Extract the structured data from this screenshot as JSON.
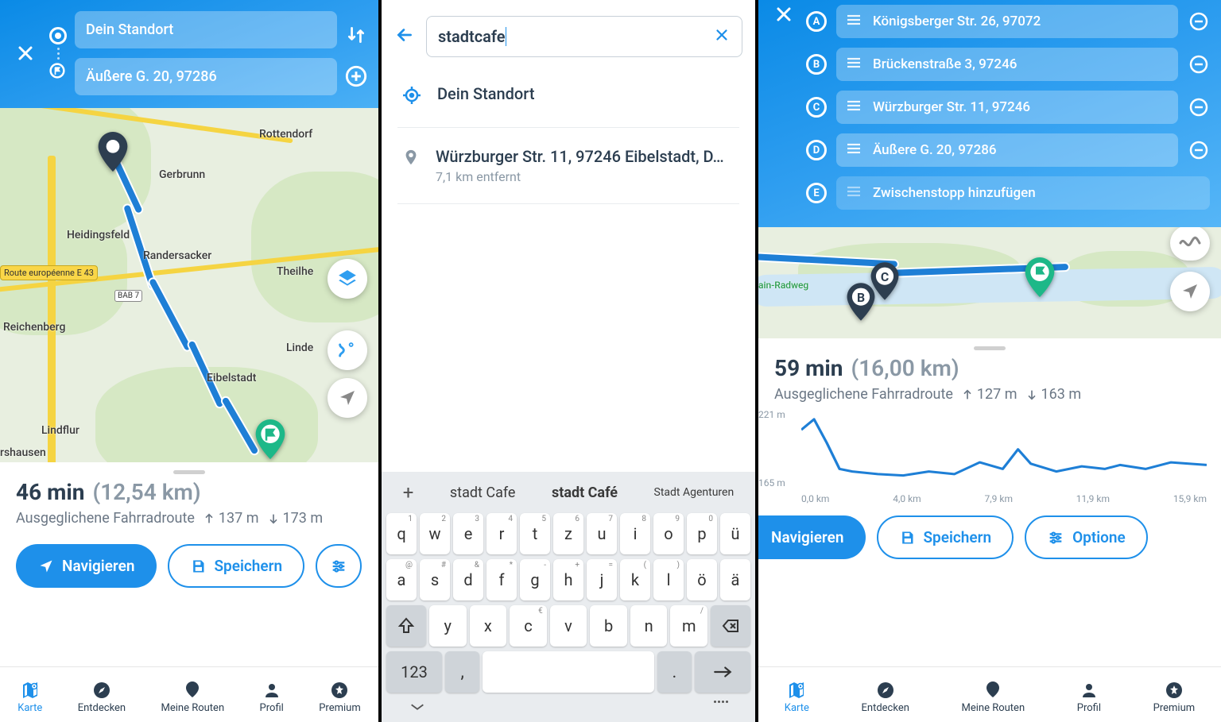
{
  "screen1": {
    "start_placeholder": "Dein Standort",
    "destination": "Äußere G. 20, 97286",
    "map_labels": {
      "rottendorf": "Rottendorf",
      "gerbrunn": "Gerbrunn",
      "heidingsfeld": "Heidingsfeld",
      "randersacker": "Randersacker",
      "theilhe": "Theilhe",
      "reichenberg": "Reichenberg",
      "linde": "Linde",
      "eibelstadt": "Eibelstadt",
      "lindflur": "Lindflur",
      "rshausen": "rshausen",
      "route_europe": "Route européenne E 43",
      "bab": "BAB 7"
    },
    "duration": "46 min",
    "distance": "(12,54 km)",
    "route_type": "Ausgeglichene Fahrradroute",
    "ascent": "137 m",
    "descent": "173 m",
    "btn_navigate": "Navigieren",
    "btn_save": "Speichern"
  },
  "screen2": {
    "search_value": "stadtcafe",
    "sugg_current": "Dein Standort",
    "sugg_addr_title": "Würzburger Str. 11, 97246 Eibelstadt, D…",
    "sugg_addr_sub": "7,1 km entfernt",
    "kbd_sugg1": "stadt Cafe",
    "kbd_sugg2": "stadt Café",
    "kbd_sugg3": "Stadt Agenturen",
    "keys_row1": [
      {
        "k": "q",
        "a": "1"
      },
      {
        "k": "w",
        "a": "2"
      },
      {
        "k": "e",
        "a": "3"
      },
      {
        "k": "r",
        "a": "4"
      },
      {
        "k": "t",
        "a": "5"
      },
      {
        "k": "z",
        "a": "6"
      },
      {
        "k": "u",
        "a": "7"
      },
      {
        "k": "i",
        "a": "8"
      },
      {
        "k": "o",
        "a": "9"
      },
      {
        "k": "p",
        "a": "0"
      },
      {
        "k": "ü",
        "a": ""
      }
    ],
    "keys_row2": [
      {
        "k": "a",
        "a": "@"
      },
      {
        "k": "s",
        "a": "#"
      },
      {
        "k": "d",
        "a": "&"
      },
      {
        "k": "f",
        "a": "*"
      },
      {
        "k": "g",
        "a": "-"
      },
      {
        "k": "h",
        "a": "+"
      },
      {
        "k": "j",
        "a": "="
      },
      {
        "k": "k",
        "a": "("
      },
      {
        "k": "l",
        "a": ")"
      },
      {
        "k": "ö",
        "a": ""
      },
      {
        "k": "ä",
        "a": ""
      }
    ],
    "keys_row3": [
      {
        "k": "y",
        "a": ""
      },
      {
        "k": "x",
        "a": ""
      },
      {
        "k": "c",
        "a": "€"
      },
      {
        "k": "v",
        "a": ""
      },
      {
        "k": "b",
        "a": ""
      },
      {
        "k": "n",
        "a": ""
      },
      {
        "k": "m",
        "a": "/"
      }
    ],
    "key_123": "123"
  },
  "screen3": {
    "stops": [
      {
        "letter": "A",
        "text": "Königsberger Str. 26, 97072"
      },
      {
        "letter": "B",
        "text": "Brückenstraße 3, 97246"
      },
      {
        "letter": "C",
        "text": "Würzburger Str. 11, 97246"
      },
      {
        "letter": "D",
        "text": "Äußere G. 20, 97286"
      },
      {
        "letter": "E",
        "text": "Zwischenstopp hinzufügen"
      }
    ],
    "map_label_radweg": "ain-Radweg",
    "duration": "59 min",
    "distance": "(16,00 km)",
    "route_type": "Ausgeglichene Fahrradroute",
    "ascent": "127 m",
    "descent": "163 m",
    "btn_navigate": "Navigieren",
    "btn_save": "Speichern",
    "btn_options": "Optione",
    "chart_data": {
      "type": "line",
      "title": "",
      "xlabel": "km",
      "ylabel": "m",
      "ylim": [
        165,
        221
      ],
      "x_ticks": [
        "0,0 km",
        "4,0 km",
        "7,9 km",
        "11,9 km",
        "15,9 km"
      ],
      "y_ticks": [
        "221 m",
        "165 m"
      ],
      "x": [
        0.0,
        0.5,
        1.0,
        1.5,
        2.0,
        3.0,
        4.0,
        5.0,
        6.0,
        7.0,
        7.9,
        8.5,
        9.0,
        10.0,
        11.0,
        11.9,
        12.5,
        13.5,
        14.5,
        15.9
      ],
      "values": [
        210,
        218,
        200,
        180,
        178,
        176,
        175,
        178,
        176,
        185,
        180,
        195,
        184,
        178,
        182,
        180,
        183,
        180,
        185,
        183
      ]
    }
  },
  "tabs": {
    "map": "Karte",
    "discover": "Entdecken",
    "routes": "Meine Routen",
    "profile": "Profil",
    "premium": "Premium"
  }
}
